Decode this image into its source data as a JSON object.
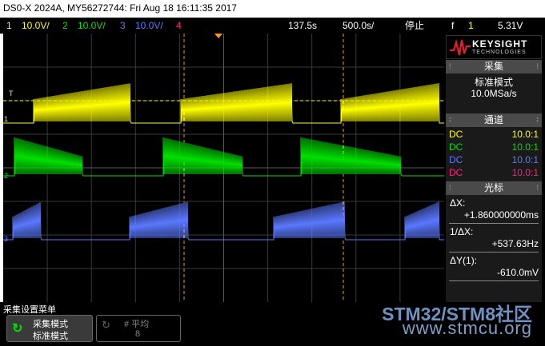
{
  "title_text": "DS0-X 2024A, MY56272744: Fri Aug 18 16:11:35 2017",
  "status": {
    "ch1_num": "1",
    "ch1_scale": "10.0V/",
    "ch2_num": "2",
    "ch2_scale": "10.0V/",
    "ch3_num": "3",
    "ch3_scale": "10.0V/",
    "ch4_num": "4",
    "delay": "137.5s",
    "timebase": "500.0s/",
    "run_state": "停止",
    "trig_icon": "f",
    "trig_src": "1",
    "trig_level": "5.31V"
  },
  "brand": {
    "name": "KEYSIGHT",
    "sub": "TECHNOLOGIES"
  },
  "acquire": {
    "header": "采集",
    "mode": "标准模式",
    "rate": "10.0MSa/s"
  },
  "channels": {
    "header": "通道",
    "rows": [
      {
        "coupling": "DC",
        "ratio": "10.0:1",
        "color": "#ffff00"
      },
      {
        "coupling": "DC",
        "ratio": "10.0:1",
        "color": "#00e000"
      },
      {
        "coupling": "DC",
        "ratio": "10.0:1",
        "color": "#5a78ff"
      },
      {
        "coupling": "DC",
        "ratio": "10.0:1",
        "color": "#ff2080"
      }
    ]
  },
  "cursors": {
    "header": "光标",
    "dx_label": "ΔX:",
    "dx_value": "+1.860000000ms",
    "inv_dx_label": "1/ΔX:",
    "inv_dx_value": "+537.63Hz",
    "dy_label": "ΔY(1):",
    "dy_value": "-610.0mV"
  },
  "markers": {
    "trigger": "T",
    "ch1": "1",
    "ch2": "2",
    "ch3": "3"
  },
  "bottom_menu": {
    "title": "采集设置菜单",
    "key1_top": "采集模式",
    "key1_bottom": "标准模式",
    "key2_top": "# 平均",
    "key2_bottom": "8"
  },
  "watermark": {
    "line1": "STM32/STM8社区",
    "line2": "www.stmcu.org"
  },
  "colors": {
    "ch1": "#ffff00",
    "ch2": "#00e000",
    "ch3": "#5a78ff",
    "ch4": "#ff2080",
    "cursor": "#ff9900"
  }
}
